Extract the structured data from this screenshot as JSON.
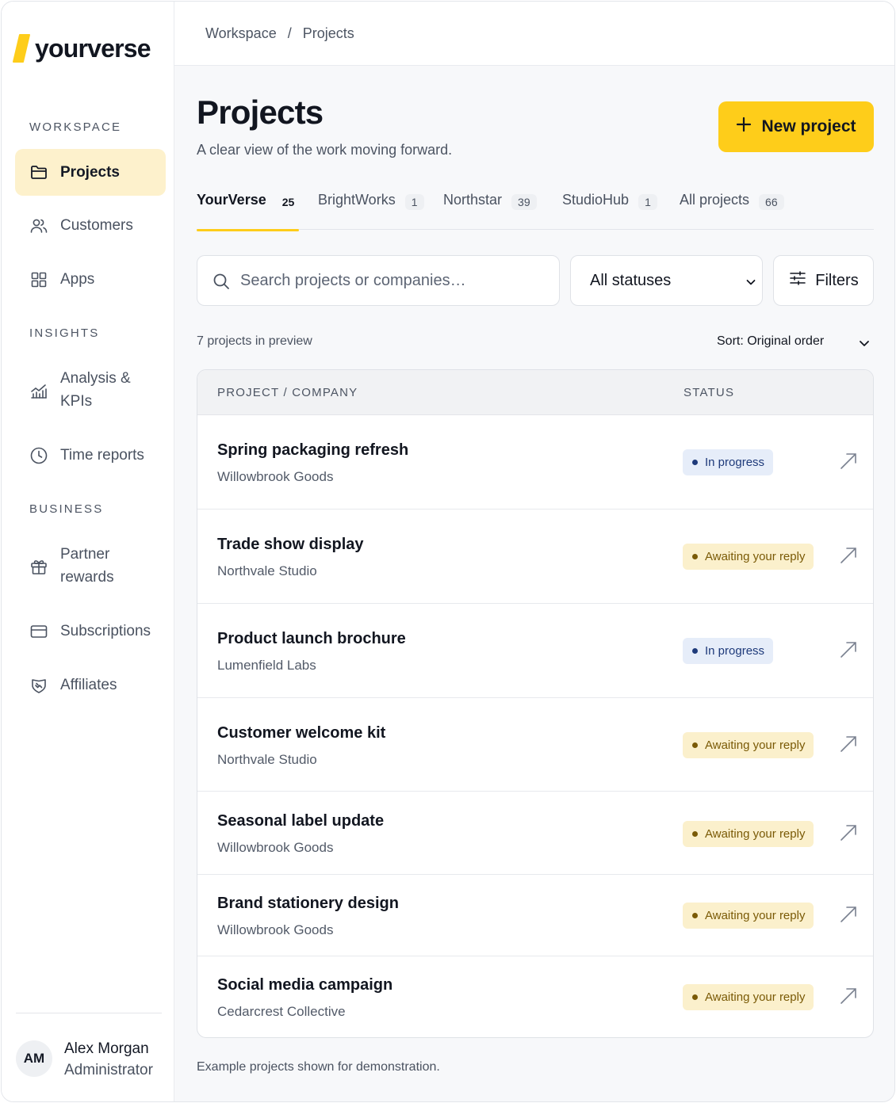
{
  "brand": {
    "name": "yourverse",
    "accent": "#fecd1a"
  },
  "sidebar": {
    "sections": [
      {
        "label": "WORKSPACE",
        "items": [
          {
            "label": "Projects",
            "icon": "folder-icon",
            "active": true
          },
          {
            "label": "Customers",
            "icon": "users-icon"
          },
          {
            "label": "Apps",
            "icon": "grid-icon"
          }
        ]
      },
      {
        "label": "INSIGHTS",
        "items": [
          {
            "label": "Analysis & KPIs",
            "icon": "chart-icon"
          },
          {
            "label": "Time reports",
            "icon": "clock-icon"
          }
        ]
      },
      {
        "label": "BUSINESS",
        "items": [
          {
            "label": "Partner rewards",
            "icon": "gift-icon"
          },
          {
            "label": "Subscriptions",
            "icon": "card-icon"
          },
          {
            "label": "Affiliates",
            "icon": "handshake-icon"
          }
        ]
      }
    ],
    "user": {
      "initials": "AM",
      "name": "Alex Morgan",
      "role": "Administrator"
    }
  },
  "breadcrumb": {
    "root": "Workspace",
    "separator": "/",
    "current": "Projects"
  },
  "header": {
    "title": "Projects",
    "subtitle": "A clear view of the work moving forward.",
    "new_button": "New project"
  },
  "tabs": [
    {
      "label": "YourVerse",
      "count": "25",
      "active": true
    },
    {
      "label": "BrightWorks",
      "count": "1"
    },
    {
      "label": "Northstar",
      "count": "39"
    },
    {
      "label": "StudioHub",
      "count": "1"
    },
    {
      "label": "All projects",
      "count": "66"
    }
  ],
  "controls": {
    "search_placeholder": "Search projects or companies…",
    "status_filter": "All statuses",
    "filters_label": "Filters",
    "preview_count": "7 projects in preview",
    "sort_label": "Sort: Original order"
  },
  "table": {
    "columns": [
      "PROJECT / COMPANY",
      "STATUS"
    ],
    "rows": [
      {
        "project": "Spring packaging refresh",
        "company": "Willowbrook Goods",
        "status": "In progress",
        "kind": "progress"
      },
      {
        "project": "Trade show display",
        "company": "Northvale Studio",
        "status": "Awaiting your reply",
        "kind": "awaiting"
      },
      {
        "project": "Product launch brochure",
        "company": "Lumenfield Labs",
        "status": "In progress",
        "kind": "progress"
      },
      {
        "project": "Customer welcome kit",
        "company": "Northvale Studio",
        "status": "Awaiting your reply",
        "kind": "awaiting"
      },
      {
        "project": "Seasonal label update",
        "company": "Willowbrook Goods",
        "status": "Awaiting your reply",
        "kind": "awaiting"
      },
      {
        "project": "Brand stationery design",
        "company": "Willowbrook Goods",
        "status": "Awaiting your reply",
        "kind": "awaiting"
      },
      {
        "project": "Social media campaign",
        "company": "Cedarcrest Collective",
        "status": "Awaiting your reply",
        "kind": "awaiting"
      }
    ]
  },
  "footnote": "Example projects shown for demonstration."
}
